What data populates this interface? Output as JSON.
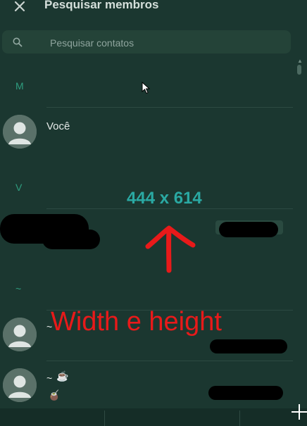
{
  "header": {
    "title": "Pesquisar membros",
    "close_icon": "close-icon"
  },
  "search": {
    "placeholder": "Pesquisar contatos",
    "value": "",
    "icon": "search-icon"
  },
  "sections": [
    {
      "letter": "M"
    },
    {
      "letter": "V"
    },
    {
      "letter": "~"
    }
  ],
  "contacts": [
    {
      "name": "Você"
    },
    {
      "name": "~"
    },
    {
      "name": "~",
      "status_emoji": "☕",
      "secondary_emoji": "🧉"
    }
  ],
  "overlay": {
    "dimensions": "444 x 614",
    "caption": "Width e height"
  },
  "colors": {
    "background": "#1b3730",
    "accent_green": "#2f9d7f",
    "overlay_teal": "#2aa9a3",
    "overlay_red": "#e81a1a"
  }
}
